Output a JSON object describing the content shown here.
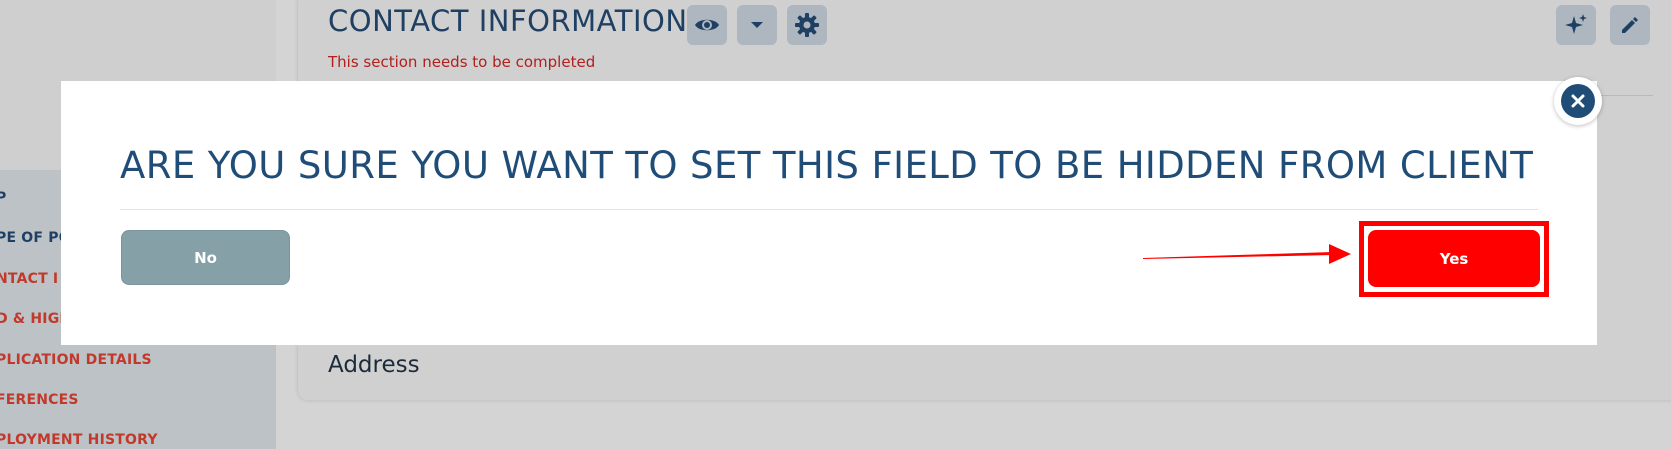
{
  "section": {
    "title": "CONTACT INFORMATION",
    "warning": "This section needs to be completed",
    "address_label": "Address"
  },
  "toolbar": {
    "visibility_icon": "eye-icon",
    "dropdown_icon": "caret-down-icon",
    "settings_icon": "gear-icon",
    "ai_icon": "sparkle-icon",
    "edit_icon": "pencil-icon"
  },
  "sidebar": {
    "items": [
      {
        "label": "P",
        "state": "normal"
      },
      {
        "label": "PE OF PO",
        "state": "normal"
      },
      {
        "label": "NTACT I",
        "state": "alert"
      },
      {
        "label": "D & HIGH",
        "state": "alert"
      },
      {
        "label": "PLICATION DETAILS",
        "state": "alert"
      },
      {
        "label": "FERENCES",
        "state": "alert"
      },
      {
        "label": "PLOYMENT HISTORY",
        "state": "alert"
      }
    ]
  },
  "modal": {
    "title": "ARE YOU SURE YOU WANT TO SET THIS FIELD TO BE HIDDEN FROM CLIENT",
    "no_label": "No",
    "yes_label": "Yes",
    "close_icon": "close-icon"
  },
  "colors": {
    "brand_navy": "#1f4d78",
    "yes_button": "#ff0000",
    "no_button": "#86a0a8",
    "alert_text": "#c0392b",
    "annotation": "#ff0000"
  }
}
